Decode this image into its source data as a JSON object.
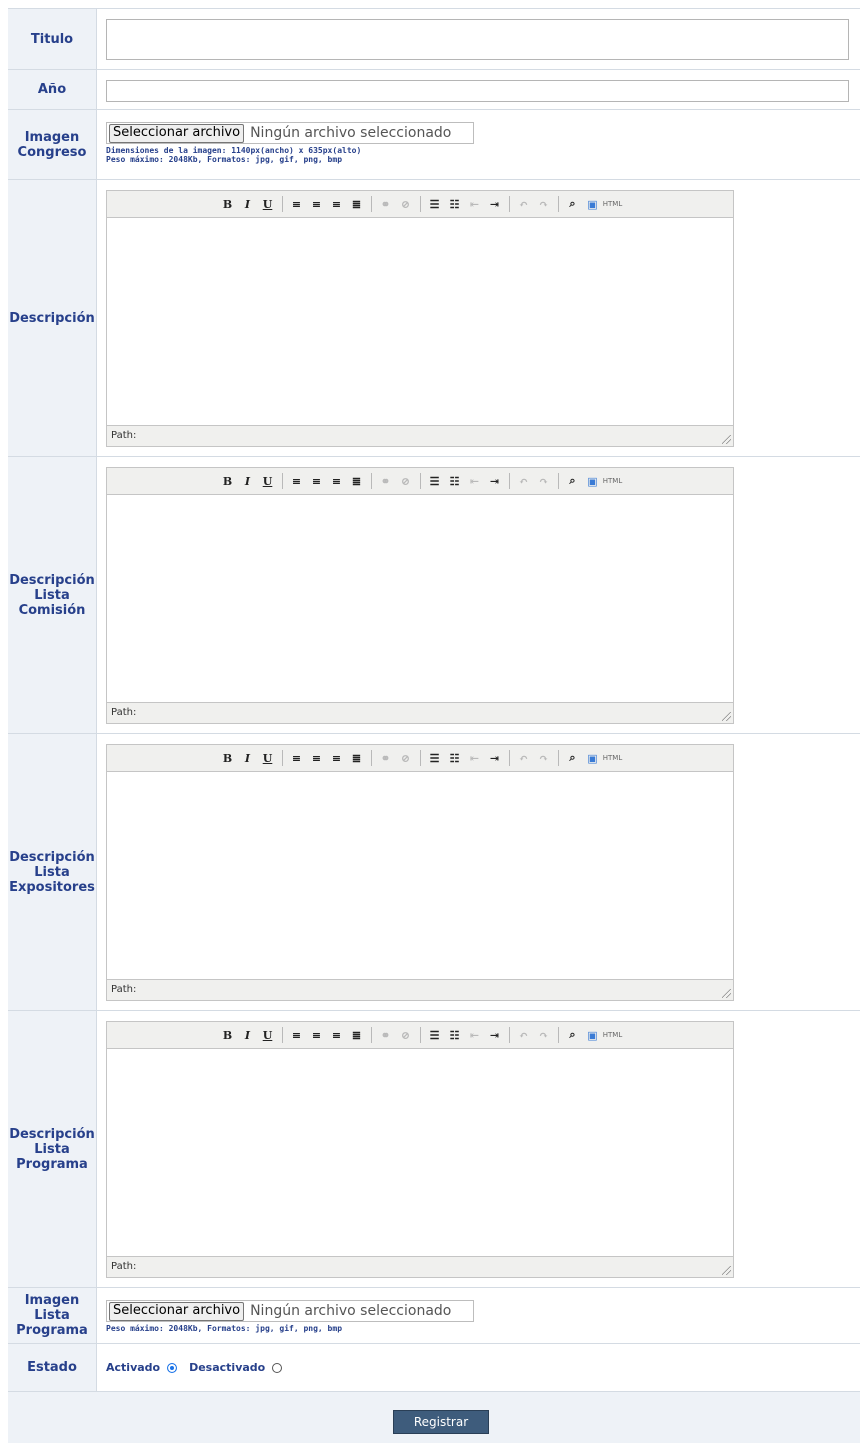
{
  "fields": {
    "titulo_label": "Titulo",
    "anio_label": "Año",
    "imagen_congreso_label": "Imagen Congreso",
    "descripcion_label": "Descripción",
    "desc_comision_label": "Descripción Lista Comisión",
    "desc_expositores_label": "Descripción Lista Expositores",
    "desc_programa_label": "Descripción Lista Programa",
    "imagen_programa_label": "Imagen Lista Programa",
    "estado_label": "Estado"
  },
  "file_input": {
    "button_label": "Seleccionar archivo",
    "no_file_text": "Ningún archivo seleccionado"
  },
  "hints": {
    "congreso_dims": "Dimensiones de la imagen: 1140px(ancho) x 635px(alto)",
    "peso": "Peso máximo: 2048Kb, Formatos: jpg, gif, png, bmp"
  },
  "editor": {
    "path_label": "Path:",
    "toolbar": {
      "bold": "B",
      "italic": "I",
      "underline": "U",
      "html": "HTML"
    }
  },
  "estado": {
    "activado": "Activado",
    "desactivado": "Desactivado",
    "selected": "Activado"
  },
  "submit_label": "Registrar"
}
